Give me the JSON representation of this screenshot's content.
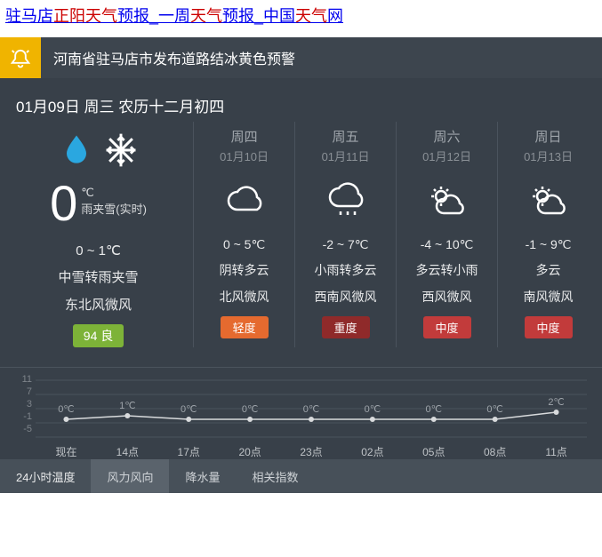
{
  "title": {
    "p1": "驻马店",
    "p2": "正阳天气",
    "p3": "预报_一周",
    "p4": "天气",
    "p5": "预报_中国",
    "p6": "天气",
    "p7": "网"
  },
  "alert": {
    "text": "河南省驻马店市发布道路结冰黄色预警"
  },
  "today": {
    "dateline": "01月09日 周三 农历十二月初四",
    "temp": "0",
    "unit": "℃",
    "realtime": "雨夹雪(实时)",
    "range": "0 ~ 1℃",
    "cond": "中雪转雨夹雪",
    "wind": "东北风微风",
    "aqi_value": "94",
    "aqi_label": "良",
    "aqi_color": "#7db338"
  },
  "days": [
    {
      "name": "周四",
      "date": "01月10日",
      "icon": "cloud",
      "range": "0 ~ 5℃",
      "cond": "阴转多云",
      "wind": "北风微风",
      "pollution": "轻度",
      "pcolor": "#e56a2f"
    },
    {
      "name": "周五",
      "date": "01月11日",
      "icon": "rain",
      "range": "-2 ~ 7℃",
      "cond": "小雨转多云",
      "wind": "西南风微风",
      "pollution": "重度",
      "pcolor": "#8f2a2a"
    },
    {
      "name": "周六",
      "date": "01月12日",
      "icon": "suncloud",
      "range": "-4 ~ 10℃",
      "cond": "多云转小雨",
      "wind": "西风微风",
      "pollution": "中度",
      "pcolor": "#c23b3b"
    },
    {
      "name": "周日",
      "date": "01月13日",
      "icon": "suncloud",
      "range": "-1 ~ 9℃",
      "cond": "多云",
      "wind": "南风微风",
      "pollution": "中度",
      "pcolor": "#c23b3b"
    }
  ],
  "chart_data": {
    "type": "line",
    "title": "",
    "xlabel": "",
    "ylabel": "",
    "ylim": [
      -5,
      11
    ],
    "y_ticks": [
      11,
      7,
      3,
      -1,
      -5
    ],
    "categories": [
      "现在",
      "14点",
      "17点",
      "20点",
      "23点",
      "02点",
      "05点",
      "08点",
      "11点"
    ],
    "values": [
      0,
      1,
      0,
      0,
      0,
      0,
      0,
      0,
      2
    ],
    "value_labels": [
      "0℃",
      "1℃",
      "0℃",
      "0℃",
      "0℃",
      "0℃",
      "0℃",
      "0℃",
      "2℃"
    ]
  },
  "tabs": {
    "label": "24小时温度",
    "items": [
      "风力风向",
      "降水量",
      "相关指数"
    ],
    "active": 0
  }
}
